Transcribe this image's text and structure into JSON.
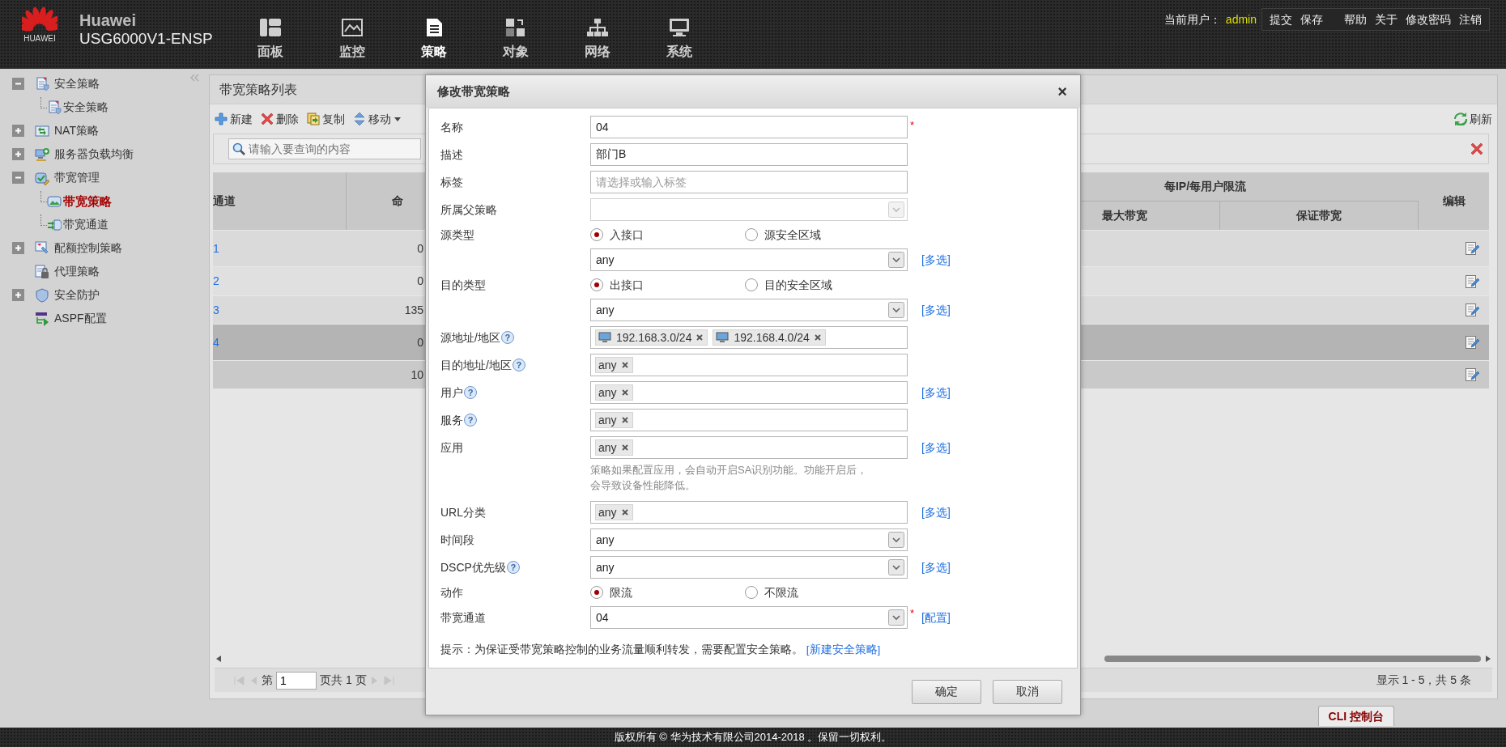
{
  "header": {
    "logo_caption": "HUAWEI",
    "brand": "Huawei",
    "product": "USG6000V1-ENSP",
    "nav": [
      {
        "label": "面板",
        "selected": false
      },
      {
        "label": "监控",
        "selected": false
      },
      {
        "label": "策略",
        "selected": true
      },
      {
        "label": "对象",
        "selected": false
      },
      {
        "label": "网络",
        "selected": false
      },
      {
        "label": "系统",
        "selected": false
      }
    ],
    "user_label": "当前用户：",
    "user": "admin",
    "action_groups": [
      [
        "提交",
        "保存"
      ],
      [
        "帮助",
        "关于",
        "修改密码",
        "注销"
      ]
    ]
  },
  "sidebar": {
    "items": [
      {
        "label": "安全策略",
        "kind": "folder",
        "expanded": true,
        "selected": false,
        "children": [
          {
            "label": "安全策略",
            "selected": false
          }
        ]
      },
      {
        "label": "NAT策略",
        "kind": "folder",
        "expanded": false,
        "selected": false
      },
      {
        "label": "服务器负载均衡",
        "kind": "folder",
        "expanded": false,
        "selected": false
      },
      {
        "label": "带宽管理",
        "kind": "folder",
        "expanded": true,
        "selected": false,
        "children": [
          {
            "label": "带宽策略",
            "selected": true
          },
          {
            "label": "带宽通道",
            "selected": false
          }
        ]
      },
      {
        "label": "配额控制策略",
        "kind": "folder",
        "expanded": false,
        "selected": false
      },
      {
        "label": "代理策略",
        "kind": "leaf",
        "selected": false
      },
      {
        "label": "安全防护",
        "kind": "folder",
        "expanded": false,
        "selected": false
      },
      {
        "label": "ASPF配置",
        "kind": "leaf",
        "selected": false
      }
    ]
  },
  "panel": {
    "title": "带宽策略列表",
    "toolbar": [
      {
        "label": "新建",
        "dropdown": false
      },
      {
        "label": "删除",
        "dropdown": false
      },
      {
        "label": "复制",
        "dropdown": false
      },
      {
        "label": "移动",
        "dropdown": true
      }
    ],
    "refresh": "刷新",
    "search": {
      "placeholder": "请输入要查询的内容"
    },
    "table": {
      "column_1": "通道",
      "column_2": "命",
      "group_header": "每IP/每用户限流",
      "sub_columns": [
        "最大带宽",
        "保证带宽"
      ],
      "edit_column": "编辑",
      "rows": [
        {
          "column_1": "1",
          "column_2": "0",
          "selected": false,
          "kind": "policy"
        },
        {
          "column_1": "2",
          "column_2": "0",
          "selected": false,
          "kind": "policy"
        },
        {
          "column_1": "3",
          "column_2": "135",
          "selected": false,
          "kind": "policy"
        },
        {
          "column_1": "4",
          "column_2": "0",
          "selected": true,
          "kind": "policy"
        },
        {
          "column_2": "10",
          "selected": false,
          "kind": "default"
        }
      ]
    },
    "pager": {
      "page_prefix": "第",
      "page": "1",
      "page_suffix": "页共 1 页",
      "summary": "显示 1 - 5，共 5 条"
    }
  },
  "cli_tab": "CLI 控制台",
  "footer": "版权所有 © 华为技术有限公司2014-2018 。保留一切权利。",
  "dialog": {
    "title": "修改带宽策略",
    "close": "×",
    "fields": [
      {
        "label": "名称",
        "kind": "text",
        "value": "04",
        "required_mark": "*"
      },
      {
        "label": "描述",
        "kind": "text",
        "value": "部门B"
      },
      {
        "label": "标签",
        "kind": "text",
        "placeholder": "请选择或输入标签"
      },
      {
        "label": "所属父策略",
        "kind": "select",
        "disabled": true
      },
      {
        "label": "源类型",
        "kind": "radio",
        "options": [
          {
            "label": "入接口",
            "selected": true
          },
          {
            "label": "源安全区域",
            "selected": false
          }
        ]
      },
      {
        "kind": "select",
        "value": "any",
        "disabled": false,
        "link": "[多选]"
      },
      {
        "label": "目的类型",
        "kind": "radio",
        "options": [
          {
            "label": "出接口",
            "selected": true
          },
          {
            "label": "目的安全区域",
            "selected": false
          }
        ]
      },
      {
        "kind": "select",
        "value": "any",
        "disabled": false,
        "link": "[多选]"
      },
      {
        "label": "源地址/地区",
        "help": "?",
        "kind": "tags",
        "tags": [
          {
            "label": "192.168.3.0/24",
            "kind": "host"
          },
          {
            "label": "192.168.4.0/24",
            "kind": "host"
          }
        ]
      },
      {
        "label": "目的地址/地区",
        "help": "?",
        "kind": "tags",
        "tags": [
          {
            "label": "any",
            "kind": "plain"
          }
        ]
      },
      {
        "label": "用户",
        "help": "?",
        "kind": "tags",
        "tags": [
          {
            "label": "any",
            "kind": "plain"
          }
        ],
        "link": "[多选]"
      },
      {
        "label": "服务",
        "help": "?",
        "kind": "tags",
        "tags": [
          {
            "label": "any",
            "kind": "plain"
          }
        ]
      },
      {
        "label": "应用",
        "kind": "tags",
        "tags": [
          {
            "label": "any",
            "kind": "plain"
          }
        ],
        "link": "[多选]",
        "note": "策略如果配置应用，会自动开启SA识别功能。功能开启后，会导致设备性能降低。"
      },
      {
        "label": "URL分类",
        "kind": "tags",
        "tags": [
          {
            "label": "any",
            "kind": "plain"
          }
        ],
        "link": "[多选]"
      },
      {
        "label": "时间段",
        "kind": "select",
        "value": "any",
        "disabled": false
      },
      {
        "label": "DSCP优先级",
        "help": "?",
        "kind": "select",
        "value": "any",
        "disabled": false,
        "link": "[多选]"
      },
      {
        "label": "动作",
        "kind": "radio",
        "options": [
          {
            "label": "限流",
            "selected": true
          },
          {
            "label": "不限流",
            "selected": false
          }
        ]
      },
      {
        "label": "带宽通道",
        "kind": "select",
        "value": "04",
        "disabled": false,
        "required_mark": "*",
        "link": "[配置]"
      }
    ],
    "hint": {
      "text": "提示：为保证受带宽策略控制的业务流量顺利转发，需要配置安全策略。",
      "link": "[新建安全策略]"
    },
    "buttons": [
      "确定",
      "取消"
    ]
  }
}
